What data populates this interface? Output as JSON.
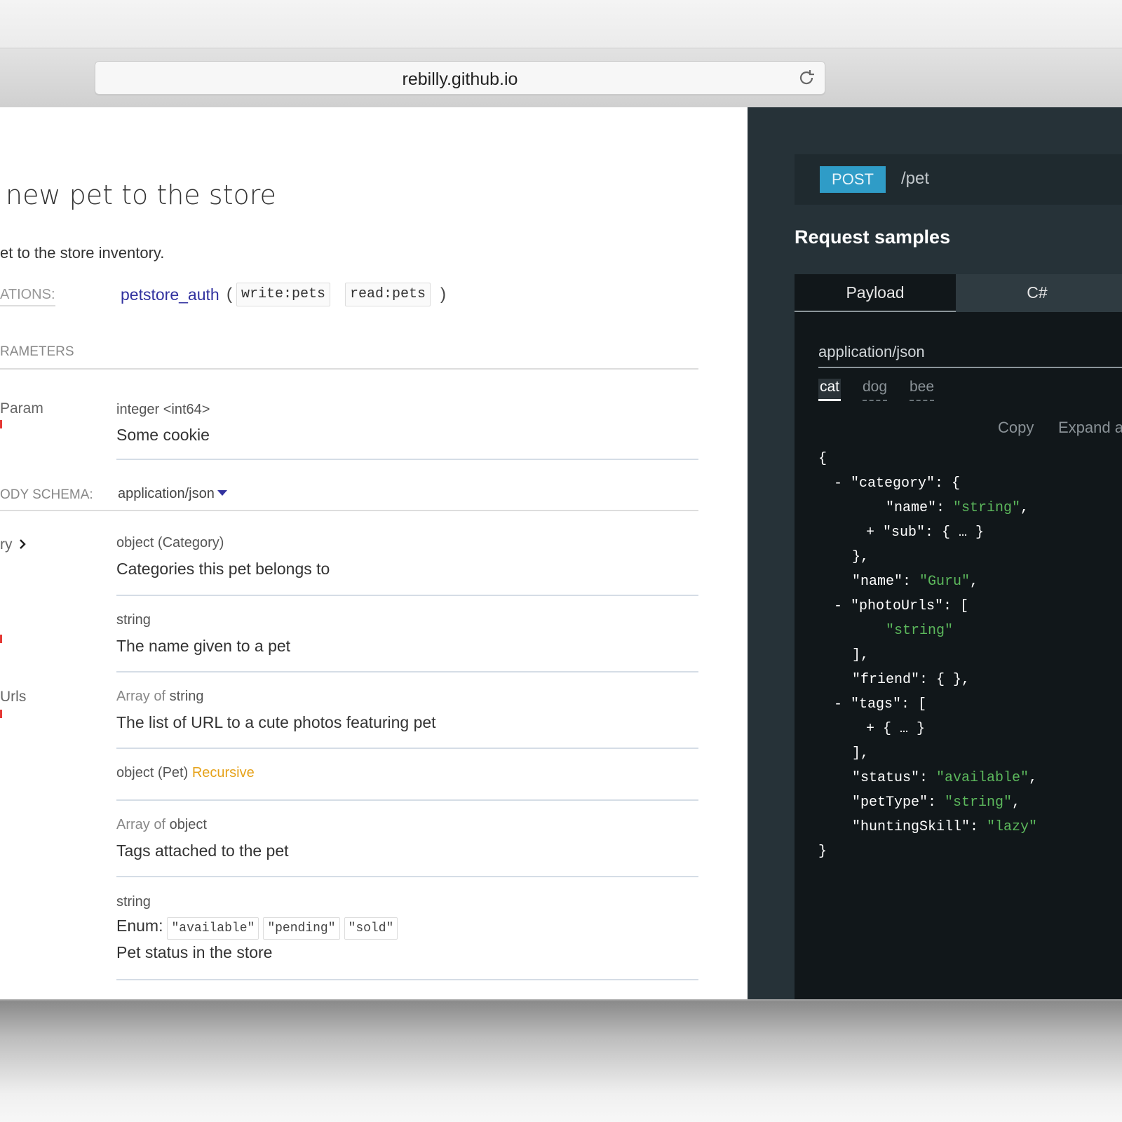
{
  "browser": {
    "address": "rebilly.github.io"
  },
  "operation": {
    "title": "new pet to the store",
    "description": "et to the store inventory.",
    "authorizations_label": "ATIONS:",
    "auth_link": "petstore_auth",
    "auth_open": "(",
    "auth_close": ")",
    "scopes": [
      "write:pets",
      "read:pets"
    ]
  },
  "parameters": {
    "header": "RAMETERS",
    "cookie_param": {
      "name": "Param",
      "type": "integer <int64>",
      "description": "Some cookie"
    }
  },
  "body_schema": {
    "label": "ODY SCHEMA:",
    "content_type": "application/json"
  },
  "fields": [
    {
      "name": "ry",
      "type_kind": "object",
      "type_rest": " (Category)",
      "description": "Categories this pet belongs to"
    },
    {
      "name": "",
      "type_kind": "string",
      "description": "The name given to a pet"
    },
    {
      "name": "Urls",
      "type_kind": "Array of",
      "type_rest": " string",
      "description": "The list of URL to a cute photos featuring pet"
    },
    {
      "name": "",
      "type_kind": "object",
      "type_rest": " (Pet) ",
      "recursive": "Recursive"
    },
    {
      "name": "",
      "type_kind": "Array of",
      "type_rest": " object",
      "description": "Tags attached to the pet"
    },
    {
      "name": "",
      "type_kind": "string",
      "enum_label": "Enum:",
      "enum_values": [
        "\"available\"",
        "\"pending\"",
        "\"sold\""
      ],
      "description": "Pet status in the store"
    }
  ],
  "right_panel": {
    "method": "POST",
    "path": "/pet",
    "samples_title": "Request samples",
    "tabs": [
      "Payload",
      "C#"
    ],
    "content_type": "application/json",
    "examples": [
      "cat",
      "dog",
      "bee"
    ],
    "actions": [
      "Copy",
      "Expand a"
    ],
    "code": {
      "l1": "{",
      "l2_tog": "- ",
      "l2": "\"category\": {",
      "l3": "\"name\": ",
      "l3_s": "\"string\"",
      "l3_end": ",",
      "l4_tog": "+ ",
      "l4": "\"sub\": { … }",
      "l5": "},",
      "l6": "\"name\": ",
      "l6_s": "\"Guru\"",
      "l6_end": ",",
      "l7_tog": "- ",
      "l7": "\"photoUrls\": [",
      "l8_s": "\"string\"",
      "l9": "],",
      "l10": "\"friend\": { },",
      "l11_tog": "- ",
      "l11": "\"tags\": [",
      "l12_tog": "+ ",
      "l12": "{ … }",
      "l13": "],",
      "l14": "\"status\": ",
      "l14_s": "\"available\"",
      "l14_end": ",",
      "l15": "\"petType\": ",
      "l15_s": "\"string\"",
      "l15_end": ",",
      "l16": "\"huntingSkill\": ",
      "l16_s": "\"lazy\"",
      "l17": "}"
    }
  }
}
